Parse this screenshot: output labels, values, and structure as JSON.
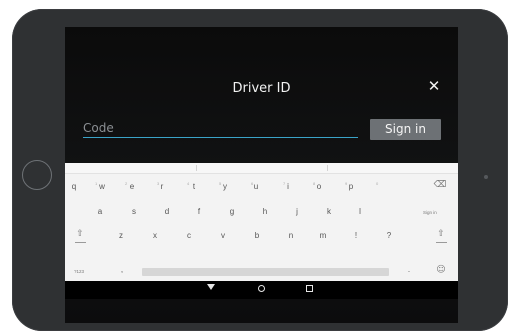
{
  "dialog": {
    "title": "Driver ID",
    "close_glyph": "✕",
    "code_placeholder": "Code",
    "sign_in_label": "Sign in"
  },
  "keyboard": {
    "row1": [
      "q",
      "w",
      "e",
      "r",
      "t",
      "y",
      "u",
      "i",
      "o",
      "p"
    ],
    "row1_hints": [
      "1",
      "2",
      "3",
      "4",
      "5",
      "6",
      "7",
      "8",
      "9",
      "0"
    ],
    "row2": [
      "a",
      "s",
      "d",
      "f",
      "g",
      "h",
      "j",
      "k",
      "l"
    ],
    "row2_action": "Sign in",
    "row3": [
      "z",
      "x",
      "c",
      "v",
      "b",
      "n",
      "m",
      "!",
      "?"
    ],
    "row4_mode": "?123",
    "row4_comma": ",",
    "row4_period": ".",
    "icons": {
      "backspace": "⌫",
      "shift": "⇧",
      "emoji": "☺"
    }
  },
  "navigation": {
    "icons": [
      "back-icon",
      "home-icon",
      "recents-icon"
    ]
  },
  "colors": {
    "accent": "#3aa3c8",
    "button": "#6d7175",
    "device_frame": "#2f3133",
    "keyboard_bg": "#f3f3f3"
  }
}
